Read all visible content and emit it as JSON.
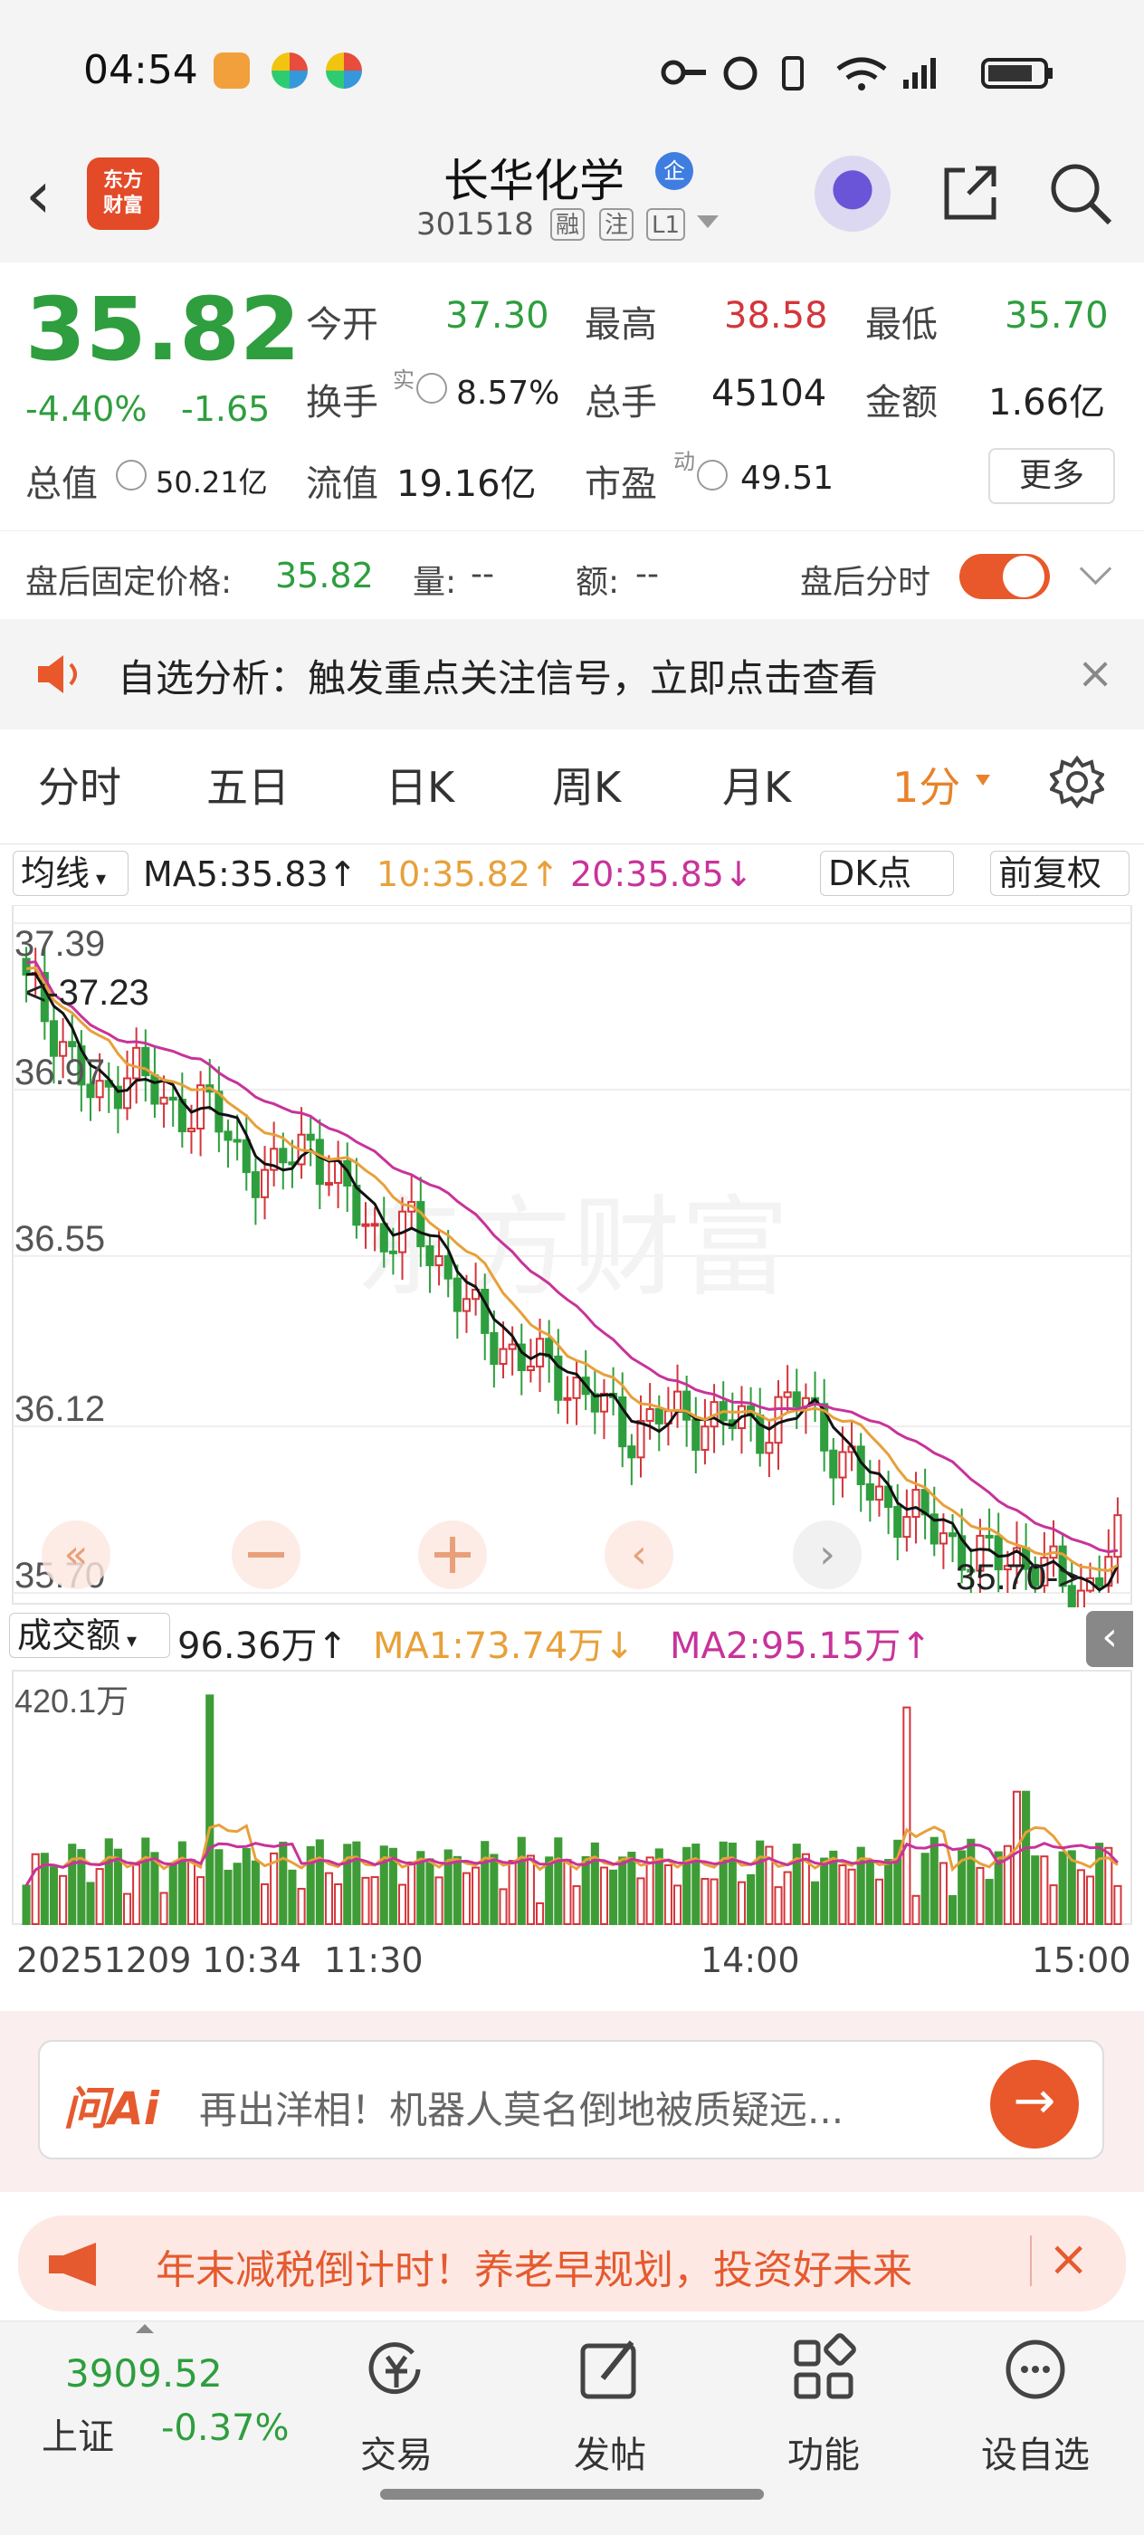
{
  "status_bar": {
    "time": "04:54"
  },
  "header": {
    "logo_line1": "东方",
    "logo_line2": "财富",
    "stock_name": "长华化学",
    "badge": "企",
    "code": "301518",
    "tags": [
      "融",
      "注",
      "L1"
    ]
  },
  "quote": {
    "price": "35.82",
    "change_pct": "-4.40%",
    "change": "-1.65",
    "open_label": "今开",
    "open": "37.30",
    "high_label": "最高",
    "high": "38.58",
    "low_label": "最低",
    "low": "35.70",
    "turnover_label": "换手",
    "turnover_sup": "实",
    "turnover": "8.57%",
    "volume_label": "总手",
    "volume": "45104",
    "amount_label": "金额",
    "amount": "1.66亿",
    "mcap_label": "总值",
    "mcap": "50.21亿",
    "float_label": "流值",
    "float": "19.16亿",
    "pe_label": "市盈",
    "pe_sup": "动",
    "pe": "49.51",
    "more": "更多"
  },
  "after_hours": {
    "price_label": "盘后固定价格:",
    "price": "35.82",
    "vol_label": "量:",
    "vol": "--",
    "amount_label": "额:",
    "amount": "--",
    "toggle_label": "盘后分时"
  },
  "notice": {
    "text": "自选分析：触发重点关注信号，立即点击查看"
  },
  "tabs": [
    "分时",
    "五日",
    "日K",
    "周K",
    "月K",
    "1分"
  ],
  "ma_row": {
    "selector": "均线",
    "ma5": "MA5:35.83",
    "ma10": "10:35.82",
    "ma20": "20:35.85",
    "dk": "DK点",
    "adjust": "前复权"
  },
  "chart_data": {
    "type": "candlestick",
    "title": "",
    "y_ticks": [
      "37.39",
      "36.97",
      "36.55",
      "36.12",
      "35.70"
    ],
    "ylim": [
      35.7,
      37.39
    ],
    "high_marker": "<-37.23",
    "low_marker": "35.70->",
    "watermark": "东方财富",
    "x_ticks": [
      "20251209 10:34",
      "11:30",
      "14:00",
      "15:00"
    ],
    "series": [
      {
        "name": "MA5",
        "color": "#111111"
      },
      {
        "name": "MA10",
        "color": "#e8a03a"
      },
      {
        "name": "MA20",
        "color": "#c8339a"
      }
    ],
    "close_trend": [
      37.23,
      37.1,
      36.92,
      37.05,
      36.9,
      36.95,
      36.8,
      36.75,
      36.85,
      36.7,
      36.6,
      36.62,
      36.5,
      36.35,
      36.3,
      36.25,
      36.2,
      36.1,
      36.15,
      36.14,
      36.13,
      36.12,
      36.2,
      36.05,
      35.95,
      35.9,
      35.85,
      35.78,
      35.8,
      35.75,
      35.7,
      35.82
    ],
    "volume": {
      "selector": "成交额",
      "value": "96.36万",
      "ma1": "MA1:73.74万",
      "ma2": "MA2:95.15万",
      "max_label": "420.1万"
    }
  },
  "ai": {
    "logo": "问Ai",
    "text": "再出洋相！机器人莫名倒地被质疑远..."
  },
  "promo": {
    "text": "年末减税倒计时！养老早规划，投资好未来"
  },
  "bottom_nav": {
    "index_value": "3909.52",
    "index_name": "上证",
    "index_change": "-0.37%",
    "items": [
      "交易",
      "发帖",
      "功能",
      "设自选"
    ]
  }
}
